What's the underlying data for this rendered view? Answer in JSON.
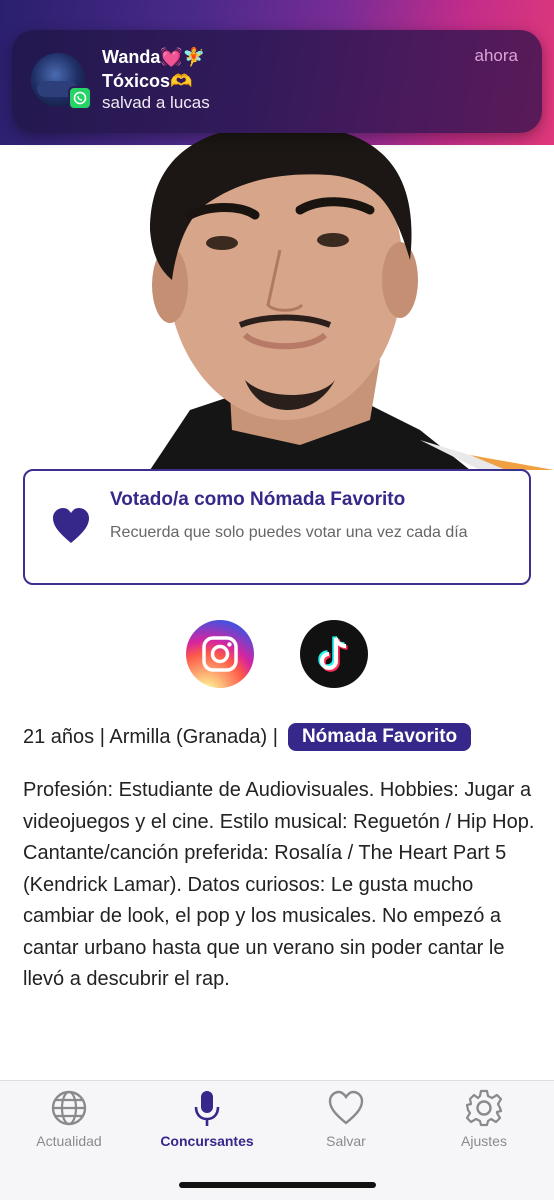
{
  "notification": {
    "title": "Wanda💓🧚",
    "subtitle": "Tóxicos🫶",
    "body": "salvad a lucas",
    "time": "ahora",
    "app_icon": "whatsapp-icon"
  },
  "vote_card": {
    "title": "Votado/a como Nómada Favorito",
    "subtitle": "Recuerda que solo puedes votar una vez cada día",
    "icon": "heart-icon"
  },
  "social": {
    "instagram_icon": "instagram-icon",
    "tiktok_icon": "tiktok-icon"
  },
  "profile": {
    "info": "21 años | Armilla (Granada) |",
    "badge": "Nómada Favorito",
    "bio": "Profesión: Estudiante de Audiovisuales.    Hobbies: Jugar a videojuegos y el cine.     Estilo musical: Reguetón / Hip Hop.    Cantante/canción preferida: Rosalía / The Heart Part 5 (Kendrick Lamar).    Datos curiosos: Le gusta mucho cambiar de look, el pop y los musicales. No empezó a cantar urbano hasta que un verano sin poder cantar le llevó a descubrir el rap."
  },
  "tabs": [
    {
      "label": "Actualidad",
      "icon": "globe-icon",
      "active": false
    },
    {
      "label": "Concursantes",
      "icon": "microphone-icon",
      "active": true
    },
    {
      "label": "Salvar",
      "icon": "heart-icon",
      "active": false
    },
    {
      "label": "Ajustes",
      "icon": "gear-icon",
      "active": false
    }
  ],
  "colors": {
    "accent": "#35288a",
    "inactive": "#8a8a8e"
  }
}
